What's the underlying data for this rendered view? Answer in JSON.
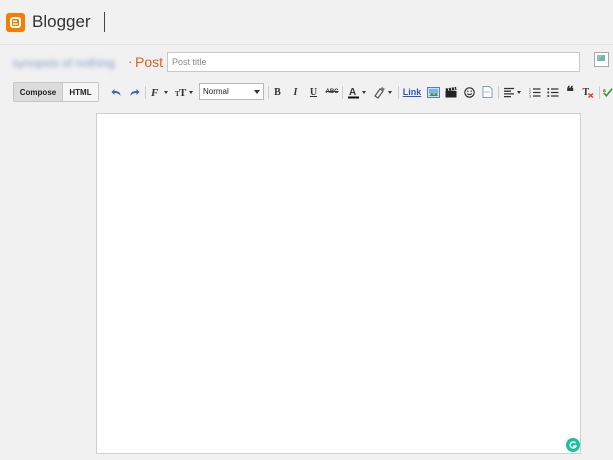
{
  "app": {
    "name": "Blogger"
  },
  "title_row": {
    "blog_name": "synopsis of nothing",
    "separator": "·",
    "post_label": "Post",
    "title_placeholder": "Post title"
  },
  "toolbar": {
    "compose_label": "Compose",
    "html_label": "HTML",
    "format_value": "Normal",
    "bold_label": "B",
    "italic_label": "I",
    "underline_label": "U",
    "strike_label": "ABC",
    "link_label": "Link",
    "quote_label": "❝"
  },
  "icons": [
    "blogger-logo-icon",
    "undo-icon",
    "redo-icon",
    "font-family-icon",
    "font-size-icon",
    "text-color-icon",
    "highlight-icon",
    "image-icon",
    "video-icon",
    "emoji-icon",
    "jump-break-icon",
    "align-icon",
    "numbered-list-icon",
    "bulleted-list-icon",
    "quote-icon",
    "clear-formatting-icon",
    "spellcheck-icon",
    "grammarly-icon"
  ],
  "colors": {
    "brand": "#f57d00",
    "post_label": "#d9621d",
    "link": "#2a56c6",
    "grammarly": "#15c39a"
  }
}
